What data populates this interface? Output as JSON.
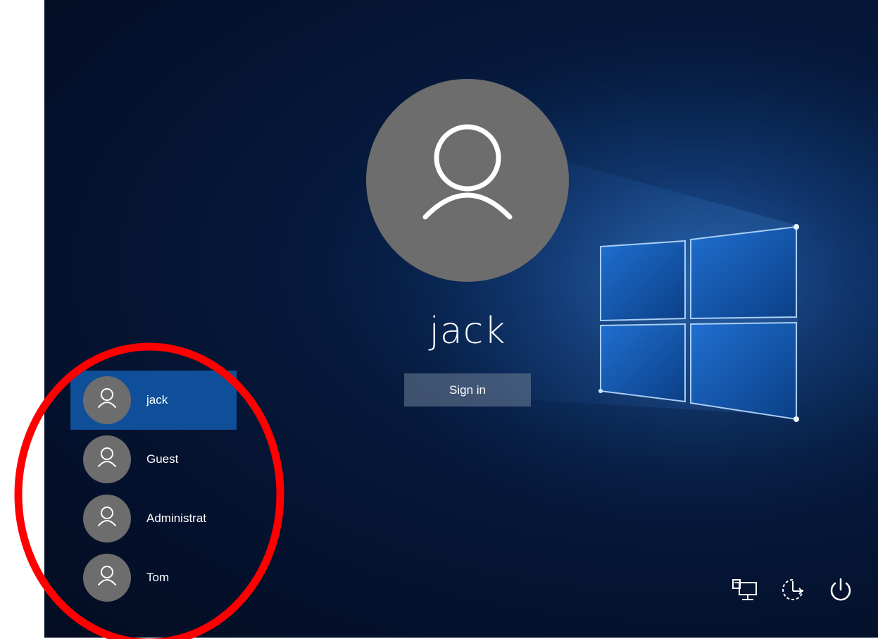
{
  "login": {
    "current_user": "jack",
    "signin_label": "Sign in"
  },
  "users": [
    {
      "name": "jack",
      "selected": true
    },
    {
      "name": "Guest",
      "selected": false
    },
    {
      "name": "Administrat",
      "selected": false
    },
    {
      "name": "Tom",
      "selected": false
    }
  ],
  "bottom_icons": [
    "network-icon",
    "ease-of-access-icon",
    "power-icon"
  ],
  "colors": {
    "selected_bg": "#0f4f99",
    "avatar_bg": "#6d6d6d",
    "highlight": "#ff0000"
  }
}
